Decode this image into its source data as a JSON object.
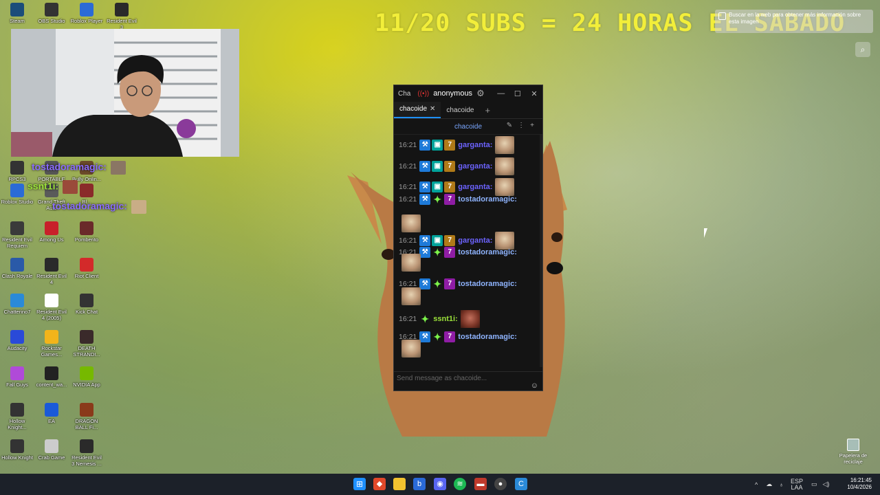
{
  "banner": "11/20 SUBS = 24 HORAS EL SABADO",
  "notice": "Buscar en la web para obtener más información sobre esta imagen",
  "desktop_icons": [
    {
      "label": "Steam",
      "icon": "steam-icon",
      "color": "#1b4d7a"
    },
    {
      "label": "OBS Studio",
      "icon": "obs-icon",
      "color": "#333"
    },
    {
      "label": "Roblox Player",
      "icon": "roblox-icon",
      "color": "#2b6bd6"
    },
    {
      "label": "Resident Evil 3",
      "icon": "re3-icon",
      "color": "#2a2a2a"
    },
    {
      "label": "RPCS3",
      "icon": "rpcs3-icon",
      "color": "#333"
    },
    {
      "label": "PORTABLE",
      "icon": "portable-icon",
      "color": "#555"
    },
    {
      "label": "Bully Onlin...",
      "icon": "bully-icon",
      "color": "#6b4a2a"
    },
    {
      "label": "Roblox Studio",
      "icon": "roblox-studio-icon",
      "color": "#2b6bd6"
    },
    {
      "label": "Grand Theft Auto",
      "icon": "gta-icon",
      "color": "#5a5a5a"
    },
    {
      "label": "Bl...",
      "icon": "bl-icon",
      "color": "#8a2a2a"
    },
    {
      "label": "Resident Evil Requiem",
      "icon": "re-requiem-icon",
      "color": "#3a3a3a"
    },
    {
      "label": "Among Us",
      "icon": "among-us-icon",
      "color": "#c8202a"
    },
    {
      "label": "Pomberito",
      "icon": "pomberito-icon",
      "color": "#6a2a2a"
    },
    {
      "label": "Clash Royale",
      "icon": "clash-royale-icon",
      "color": "#2a5aa8"
    },
    {
      "label": "Resident Evil 4",
      "icon": "re4-icon",
      "color": "#2a2a2a"
    },
    {
      "label": "Riot Client",
      "icon": "riot-icon",
      "color": "#d32a2a"
    },
    {
      "label": "Chatterino7",
      "icon": "chatterino-icon",
      "color": "#2a8ad8"
    },
    {
      "label": "Resident Evil 4 (2005)",
      "icon": "re4-2005-icon",
      "color": "#fff"
    },
    {
      "label": "Kick Chat",
      "icon": "kick-chat-icon",
      "color": "#333"
    },
    {
      "label": "Audacity",
      "icon": "audacity-icon",
      "color": "#2a4ad8"
    },
    {
      "label": "Rockstar Games...",
      "icon": "rockstar-icon",
      "color": "#f2b41a"
    },
    {
      "label": "DEATH STRANDI...",
      "icon": "death-stranding-icon",
      "color": "#3a2a2a"
    },
    {
      "label": "Fall Guys",
      "icon": "fall-guys-icon",
      "color": "#b04ad8"
    },
    {
      "label": "content_wa...",
      "icon": "content-icon",
      "color": "#222"
    },
    {
      "label": "NVIDIA App",
      "icon": "nvidia-icon",
      "color": "#76b900"
    },
    {
      "label": "Hollow Knight...",
      "icon": "hollow-knight-icon",
      "color": "#333"
    },
    {
      "label": "EA",
      "icon": "ea-icon",
      "color": "#1a5ad8"
    },
    {
      "label": "DRAGON BALL Fi...",
      "icon": "dragon-ball-icon",
      "color": "#8a3a1a"
    },
    {
      "label": "Hollow Knight",
      "icon": "hollow-knight2-icon",
      "color": "#333"
    },
    {
      "label": "Crab Game",
      "icon": "crab-game-icon",
      "color": "#ccc"
    },
    {
      "label": "Resident Evil 3 Nemesis ...",
      "icon": "re3-nemesis-icon",
      "color": "#2a2a2a"
    }
  ],
  "overlay": [
    {
      "name": "tostadoramagic:",
      "color": "#7b4fff"
    },
    {
      "name": "ssnt1i:",
      "color": "#9be23a"
    },
    {
      "name": "tostadoramagic:",
      "color": "#7b4fff"
    }
  ],
  "chat": {
    "app": "Cha",
    "live_icon": "live-icon",
    "user": "anonymous",
    "tabs": [
      {
        "label": "chacoide",
        "active": true
      },
      {
        "label": "chacoide",
        "active": false
      }
    ],
    "channel": "chacoide",
    "placeholder": "Send message as chacoide...",
    "messages": [
      {
        "time": "16:21",
        "name": "garganta:",
        "color": "#6c63ff",
        "badges": [
          "mod",
          "vip",
          "gold"
        ]
      },
      {
        "time": "16:21",
        "name": "garganta:",
        "color": "#6c63ff",
        "badges": [
          "mod",
          "vip",
          "gold"
        ]
      },
      {
        "time": "16:21",
        "name": "garganta:",
        "color": "#6c63ff",
        "badges": [
          "mod",
          "vip",
          "gold"
        ]
      },
      {
        "time": "16:21",
        "name": "tostadoramagic:",
        "color": "#8fb4ff",
        "badges": [
          "mod",
          "star",
          "pur"
        ]
      },
      {
        "time": "16:21",
        "name": "garganta:",
        "color": "#6c63ff",
        "badges": [
          "mod",
          "vip",
          "gold"
        ]
      },
      {
        "time": "16:21",
        "name": "tostadoramagic:",
        "color": "#8fb4ff",
        "badges": [
          "mod",
          "star",
          "pur"
        ]
      },
      {
        "time": "16:21",
        "name": "tostadoramagic:",
        "color": "#8fb4ff",
        "badges": [
          "mod",
          "star",
          "pur"
        ]
      },
      {
        "time": "16:21",
        "name": "ssnt1i:",
        "color": "#9be23a",
        "badges": [
          "star"
        ]
      },
      {
        "time": "16:21",
        "name": "tostadoramagic:",
        "color": "#8fb4ff",
        "badges": [
          "mod",
          "star",
          "pur"
        ]
      }
    ]
  },
  "recycle_bin": "Papelera de reciclaje",
  "taskbar": {
    "lang": "ESP",
    "layout": "LAA",
    "time": "16:21:45",
    "date": "10/4/2026"
  }
}
